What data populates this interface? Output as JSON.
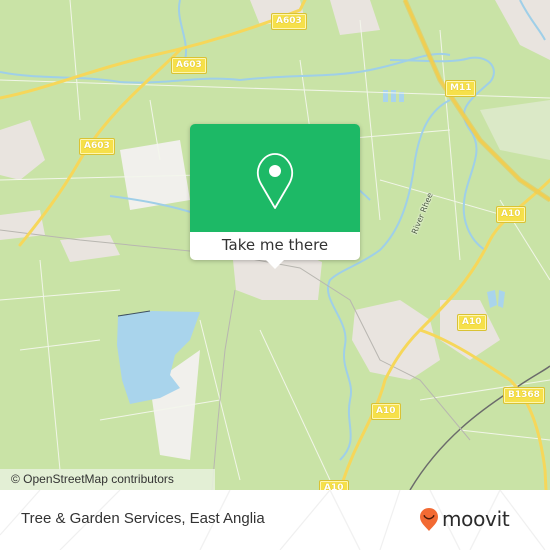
{
  "map": {
    "attribution": "© OpenStreetMap contributors",
    "colors": {
      "land": "#c9e3a6",
      "water": "#a9d4ec",
      "urban": "#e8e1df",
      "major_road": "#f6d75a",
      "road_label_bg": "#f6e04a",
      "railway": "#6b6b6b"
    },
    "road_labels": [
      {
        "id": "a603-top",
        "text": "A603"
      },
      {
        "id": "a603-mid",
        "text": "A603"
      },
      {
        "id": "a603-left",
        "text": "A603"
      },
      {
        "id": "m11",
        "text": "M11"
      },
      {
        "id": "a10-right",
        "text": "A10"
      },
      {
        "id": "a10-mid",
        "text": "A10"
      },
      {
        "id": "a10-low",
        "text": "A10"
      },
      {
        "id": "a10-bottom",
        "text": "A10"
      },
      {
        "id": "b1368",
        "text": "B1368"
      }
    ],
    "water_labels": [
      {
        "id": "river-rhee",
        "text": "River Rhee"
      }
    ]
  },
  "popup": {
    "icon": "map-pin-icon",
    "action_label": "Take me there",
    "accent_color": "#1db966"
  },
  "footer": {
    "place_title": "Tree & Garden Services, East Anglia",
    "brand": "moovit",
    "brand_icon": "moovit-pin-smile-icon",
    "brand_color": "#f26a33"
  }
}
